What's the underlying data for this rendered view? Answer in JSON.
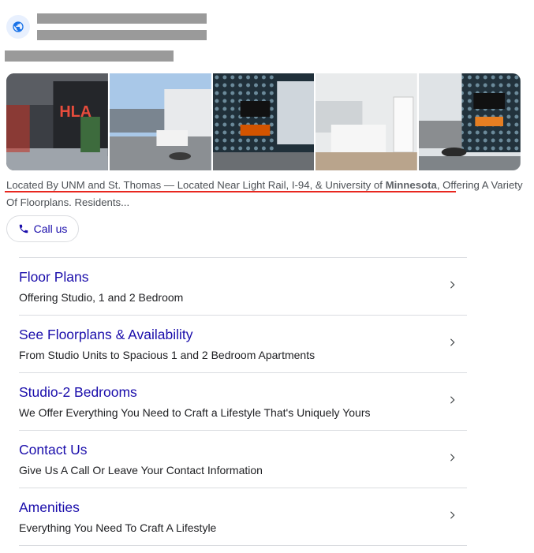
{
  "snippet": {
    "part1": "Located By UNM and St. Thomas — Located Near Light Rail, I-94, & University of ",
    "bold": "Minnesota",
    "part2": ", Offering A Variety Of Floorplans. Residents..."
  },
  "call_button": {
    "label": "Call us",
    "icon": "phone-icon"
  },
  "sitelinks": [
    {
      "title": "Floor Plans",
      "description": "Offering Studio, 1 and 2 Bedroom"
    },
    {
      "title": "See Floorplans & Availability",
      "description": "From Studio Units to Spacious 1 and 2 Bedroom Apartments"
    },
    {
      "title": "Studio-2 Bedrooms",
      "description": "We Offer Everything You Need to Craft a Lifestyle That's Uniquely Yours"
    },
    {
      "title": "Contact Us",
      "description": "Give Us A Call Or Leave Your Contact Information"
    },
    {
      "title": "Amenities",
      "description": "Everything You Need To Craft A Lifestyle"
    }
  ],
  "colors": {
    "link": "#1a0dab",
    "underline": "#e8271f",
    "divider": "#dadce0"
  },
  "gallery": {
    "logo_text": "HLA"
  }
}
